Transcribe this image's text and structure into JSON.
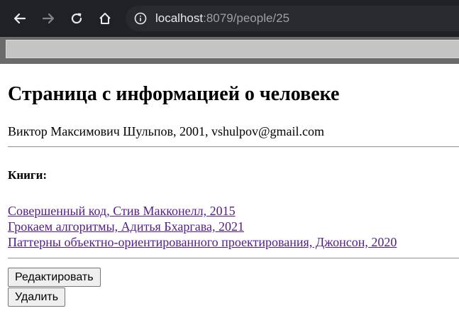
{
  "browser": {
    "url_host": "localhost",
    "url_rest": ":8079/people/25"
  },
  "page": {
    "title": "Страница с информацией о человеке",
    "person_info": "Виктор Максимович Шульпов, 2001, vshulpov@gmail.com",
    "books_heading": "Книги:",
    "books": [
      "Совершенный код, Стив Макконелл, 2015",
      "Грокаем алгоритмы, Адитья Бхаргава, 2021",
      "Паттерны объектно-ориентированного проектирования, Джонсон, 2020"
    ],
    "edit_button": "Редактировать",
    "delete_button": "Удалить"
  },
  "colors": {
    "visited_link": "#551a8b",
    "toolbar_bg": "#202124"
  },
  "icons": [
    "back-arrow-icon",
    "forward-arrow-icon",
    "reload-icon",
    "home-icon",
    "info-icon"
  ]
}
